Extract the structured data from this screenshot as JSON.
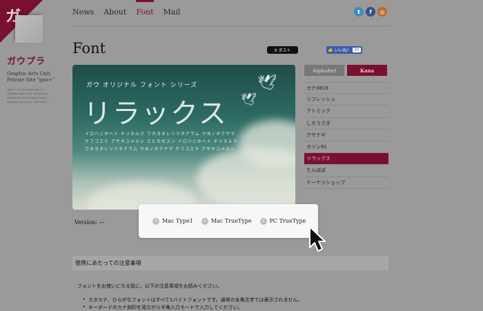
{
  "brand": {
    "corner_glyph": "ガ",
    "logo_text": "ガウプラ",
    "subtitle_1": "Graphic Arts Unit",
    "subtitle_2": "Private Site \"gau+\"",
    "blurb": "\"gau+\" is a private site of Graphic Arts Unit. It has free download of Prototype fonts / Typeface projects, and more..."
  },
  "nav": {
    "items": [
      {
        "label": "News"
      },
      {
        "label": "About"
      },
      {
        "label": "Font"
      },
      {
        "label": "Mail"
      }
    ],
    "active": "Font"
  },
  "social": {
    "icons": [
      "twitter-icon",
      "facebook-icon",
      "rss-icon"
    ],
    "glyphs": [
      "t",
      "f",
      "◎"
    ]
  },
  "page": {
    "title": "Font",
    "post_button": "X ポスト",
    "like_label": "いいね！",
    "like_count": "30"
  },
  "hero": {
    "series": "ガウ オリジナル フォント シリーズ",
    "title": "リラックス",
    "sample_lines": [
      "イロハニホヘト チリヌルヲ ワカヨタレソツネナラム ウヰノオクヤマ",
      "ケフコエテ アサキユメミシ ヱヒモセスン イロハニホヘト チリヌルヲ",
      "ワカヨタレソツネナラム ウヰノオクヤマ ケフコエテ アサキユメミシ"
    ]
  },
  "version": {
    "label": "Version: ---"
  },
  "downloads": [
    {
      "label": "Mac Type1"
    },
    {
      "label": "Mac TrueType"
    },
    {
      "label": "PC TrueType"
    }
  ],
  "sidebar": {
    "tabs": [
      {
        "label": "Alphabet"
      },
      {
        "label": "Kana"
      }
    ],
    "active_tab": "Kana",
    "fonts": [
      {
        "label": "カナ0816"
      },
      {
        "label": "リフレッシュ"
      },
      {
        "label": "アトミック"
      },
      {
        "label": "しろうさぎ"
      },
      {
        "label": "クサナギ"
      },
      {
        "label": "カリン91"
      },
      {
        "label": "リラックス"
      },
      {
        "label": "たんぽぽ"
      },
      {
        "label": "ドーナツショップ"
      }
    ],
    "selected": "リラックス"
  },
  "notes": {
    "heading": "使用にあたっての注意事項",
    "intro": "フォントをお使いになる前に、以下の注意事項をお読みください。",
    "items": [
      "カタカナ、ひらがなフォントはすべて1バイトフォントです。通常の全角文字では表示されません。",
      "キーボードのカナ刻印を見ながら半角入力モードで入力してください。"
    ]
  },
  "colors": {
    "accent": "#7a1030",
    "background": "#9a9a9a"
  }
}
